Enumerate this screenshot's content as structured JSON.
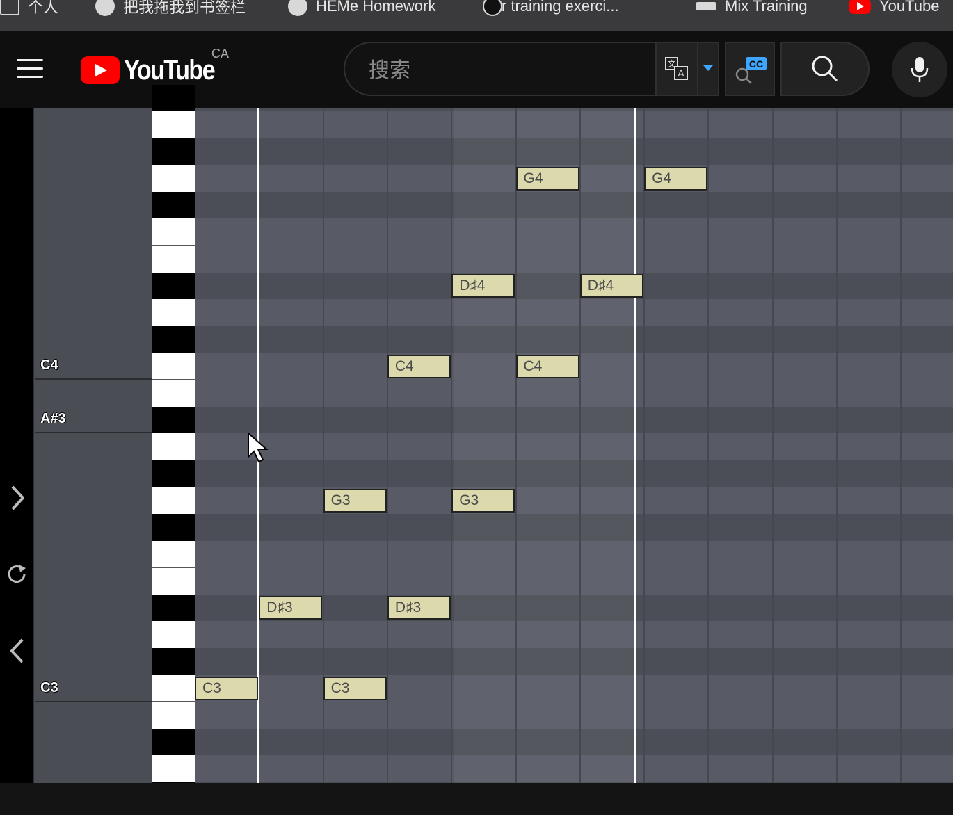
{
  "bookmarks": [
    {
      "label": "个人",
      "icon": "folder-icon"
    },
    {
      "label": "把我拖我到书签栏",
      "icon": "globe-icon"
    },
    {
      "label": "HEMe Homework",
      "icon": "globe-icon"
    },
    {
      "label": "Ear training exerci...",
      "icon": "music-note-icon"
    },
    {
      "label": "Mix Training",
      "icon": "dumbbell-icon"
    },
    {
      "label": "YouTube",
      "icon": "youtube-icon"
    }
  ],
  "header": {
    "logo_text": "YouTube",
    "country_code": "CA",
    "search_placeholder": "搜索",
    "cc_badge": "CC"
  },
  "piano_roll": {
    "key_labels": [
      "C4",
      "A#3",
      "C3"
    ],
    "notes": [
      {
        "pitch": "G4",
        "beat": 5
      },
      {
        "pitch": "G4",
        "beat": 7
      },
      {
        "pitch": "D#4",
        "beat": 4
      },
      {
        "pitch": "D#4",
        "beat": 6
      },
      {
        "pitch": "C4",
        "beat": 3
      },
      {
        "pitch": "C4",
        "beat": 5
      },
      {
        "pitch": "G3",
        "beat": 2
      },
      {
        "pitch": "G3",
        "beat": 4
      },
      {
        "pitch": "D#3",
        "beat": 1
      },
      {
        "pitch": "D#3",
        "beat": 3
      },
      {
        "pitch": "C3",
        "beat": 0
      },
      {
        "pitch": "C3",
        "beat": 2
      }
    ]
  },
  "colors": {
    "note_fill": "#dcd9ad",
    "roll_bg": "#585b66",
    "youtube_red": "#ff0000"
  }
}
